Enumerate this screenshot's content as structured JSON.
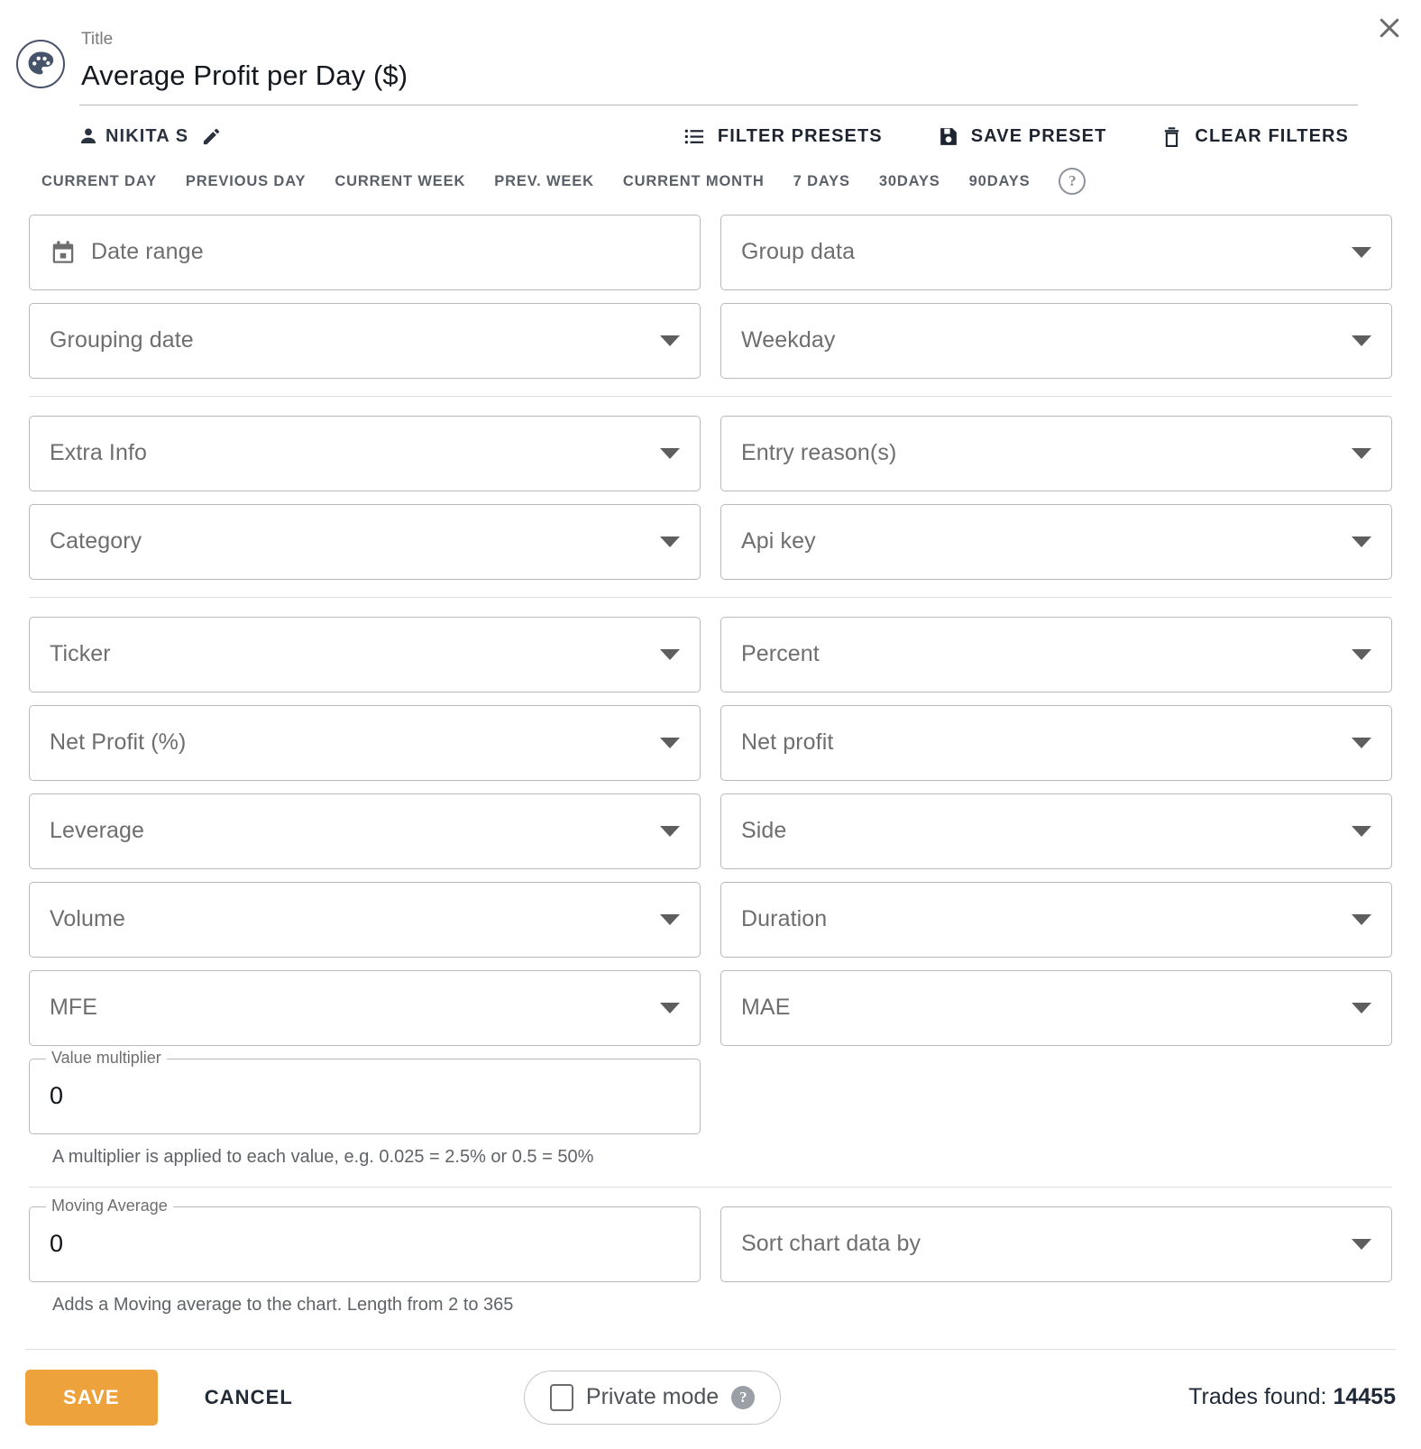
{
  "dialog": {
    "close_icon": "close-icon",
    "palette_icon": "palette-icon"
  },
  "title": {
    "label": "Title",
    "value": "Average Profit per Day ($)"
  },
  "toolbar": {
    "owner": "NIKITA S",
    "owner_icon": "person-icon",
    "edit_icon": "pencil-icon",
    "actions": [
      {
        "label": "FILTER PRESETS",
        "icon": "list-icon"
      },
      {
        "label": "SAVE PRESET",
        "icon": "save-disk-icon"
      },
      {
        "label": "CLEAR FILTERS",
        "icon": "trash-icon"
      }
    ]
  },
  "quick_tabs": {
    "items": [
      "CURRENT DAY",
      "PREVIOUS DAY",
      "CURRENT WEEK",
      "PREV. WEEK",
      "CURRENT MONTH",
      "7 DAYS",
      "30DAYS",
      "90DAYS"
    ],
    "help_icon": "help-circle-icon",
    "help_glyph": "?"
  },
  "sections": [
    {
      "fields": [
        {
          "placeholder": "Date range",
          "icon": "calendar-icon",
          "caret": false
        },
        {
          "placeholder": "Group data",
          "icon": null,
          "caret": true
        },
        {
          "placeholder": "Grouping date",
          "icon": null,
          "caret": true
        },
        {
          "placeholder": "Weekday",
          "icon": null,
          "caret": true
        }
      ]
    },
    {
      "fields": [
        {
          "placeholder": "Extra Info",
          "icon": null,
          "caret": true
        },
        {
          "placeholder": "Entry reason(s)",
          "icon": null,
          "caret": true
        },
        {
          "placeholder": "Category",
          "icon": null,
          "caret": true
        },
        {
          "placeholder": "Api key",
          "icon": null,
          "caret": true
        }
      ]
    },
    {
      "fields": [
        {
          "placeholder": "Ticker",
          "icon": null,
          "caret": true
        },
        {
          "placeholder": "Percent",
          "icon": null,
          "caret": true
        },
        {
          "placeholder": "Net Profit (%)",
          "icon": null,
          "caret": true
        },
        {
          "placeholder": "Net profit",
          "icon": null,
          "caret": true
        },
        {
          "placeholder": "Leverage",
          "icon": null,
          "caret": true
        },
        {
          "placeholder": "Side",
          "icon": null,
          "caret": true
        },
        {
          "placeholder": "Volume",
          "icon": null,
          "caret": true
        },
        {
          "placeholder": "Duration",
          "icon": null,
          "caret": true
        },
        {
          "placeholder": "MFE",
          "icon": null,
          "caret": true
        },
        {
          "placeholder": "MAE",
          "icon": null,
          "caret": true
        }
      ]
    }
  ],
  "value_multiplier": {
    "label": "Value multiplier",
    "value": "0",
    "helper": "A multiplier is applied to each value, e.g. 0.025 = 2.5% or 0.5 = 50%"
  },
  "moving_average": {
    "label": "Moving Average",
    "value": "0",
    "helper": "Adds a Moving average to the chart. Length from 2 to 365"
  },
  "sort_chart": {
    "placeholder": "Sort chart data by"
  },
  "footer": {
    "save_label": "SAVE",
    "cancel_label": "CANCEL",
    "private_label": "Private mode",
    "private_help_glyph": "?",
    "trades_label": "Trades found:",
    "trades_count": "14455",
    "save_color": "#eda23c"
  }
}
